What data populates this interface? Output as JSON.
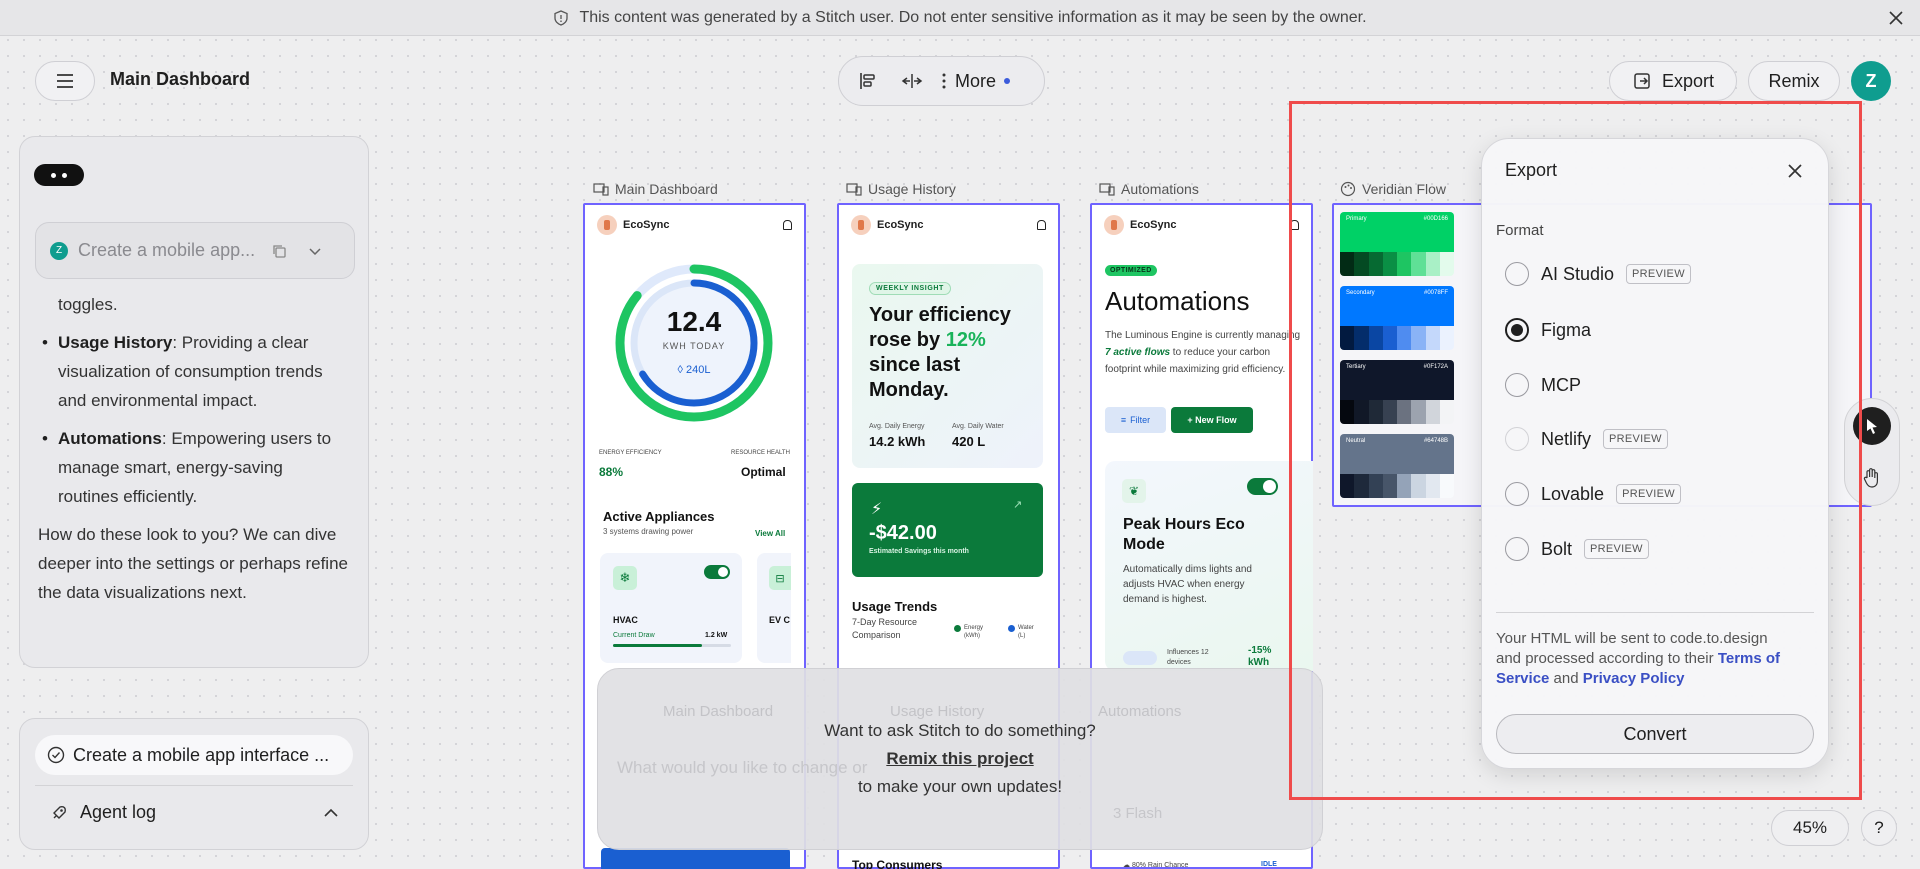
{
  "banner": {
    "text": "This content was generated by a Stitch user. Do not enter sensitive information as it may be seen by the owner."
  },
  "header": {
    "title": "Main Dashboard",
    "toolbar_more": "More",
    "export_label": "Export",
    "remix_label": "Remix",
    "avatar_initial": "Z"
  },
  "chat": {
    "prompt_placeholder": "Create a mobile app...",
    "fragment": "toggles.",
    "items": [
      {
        "title": "Usage History",
        "text": ": Providing a clear visualization of consumption trends and environmental impact."
      },
      {
        "title": "Automations",
        "text": ": Empowering users to manage smart, energy-saving routines efficiently."
      }
    ],
    "closing": "How do these look to you? We can dive deeper into the settings or perhaps refine the data visualizations next.",
    "task_label": "Create a mobile app interface ...",
    "agent_log_label": "Agent log"
  },
  "artboards": {
    "main": {
      "label": "Main Dashboard",
      "app_name": "EcoSync",
      "kwh_value": "12.4",
      "kwh_label": "KWH TODAY",
      "water_value": "240L",
      "efficiency_label": "ENERGY EFFICIENCY",
      "efficiency_value": "88%",
      "health_label": "RESOURCE HEALTH",
      "health_value": "Optimal",
      "appliances_title": "Active Appliances",
      "appliances_sub": "3 systems drawing power",
      "view_all": "View All",
      "hvac_label": "HVAC",
      "hvac_draw_label": "Current Draw",
      "hvac_draw_value": "1.2 kW",
      "ev_label": "EV C"
    },
    "usage": {
      "label": "Usage History",
      "app_name": "EcoSync",
      "weekly_tag": "WEEKLY INSIGHT",
      "headline_1": "Your efficiency rose by ",
      "headline_pct": "12%",
      "headline_2": " since last Monday.",
      "energy_label": "Avg. Daily Energy",
      "energy_value": "14.2 kWh",
      "water_label": "Avg. Daily Water",
      "water_value": "420 L",
      "savings_value": "-$42.00",
      "savings_label": "Estimated Savings this month",
      "trends_title": "Usage Trends",
      "trends_sub": "7-Day Resource Comparison",
      "legend_energy": "Energy (kWh)",
      "legend_water": "Water (L)",
      "bottom_title": "Top Consumers"
    },
    "automations": {
      "label": "Automations",
      "app_name": "EcoSync",
      "tag": "OPTIMIZED",
      "title": "Automations",
      "desc_1": "The Luminous Engine is currently managing ",
      "desc_em": "7 active flows",
      "desc_2": " to reduce your carbon footprint while maximizing grid efficiency.",
      "filter_label": "Filter",
      "new_flow_label": "+ New Flow",
      "card_title": "Peak Hours Eco Mode",
      "card_desc": "Automatically dims lights and adjusts HVAC when energy demand is highest.",
      "influences": "Influences 12 devices",
      "savings": "-15% kWh",
      "rain": "80% Rain Chance",
      "idle": "IDLE"
    },
    "palette": {
      "label": "Veridian Flow",
      "swatches": [
        {
          "name": "Primary",
          "hex": "#00D166"
        },
        {
          "name": "Secondary",
          "hex": "#0078FF"
        },
        {
          "name": "Tertiary",
          "hex": "#0F172A"
        },
        {
          "name": "Neutral",
          "hex": "#64748B"
        }
      ]
    }
  },
  "remix_overlay": {
    "line1": "Want to ask Stitch to do something?",
    "link": "Remix this project",
    "line3": "to make your own updates!",
    "bg_tab_1": "Main Dashboard",
    "bg_tab_2": "Usage History",
    "bg_tab_3": "Automations",
    "bg_input": "What would you like to change or",
    "bg_model": "3 Flash"
  },
  "export_dialog": {
    "title": "Export",
    "format_label": "Format",
    "options": [
      {
        "label": "AI Studio",
        "badge": "PREVIEW",
        "selected": false
      },
      {
        "label": "Figma",
        "badge": "",
        "selected": true
      },
      {
        "label": "MCP",
        "badge": "",
        "selected": false
      },
      {
        "label": "Netlify",
        "badge": "PREVIEW",
        "selected": false
      },
      {
        "label": "Lovable",
        "badge": "PREVIEW",
        "selected": false
      },
      {
        "label": "Bolt",
        "badge": "PREVIEW",
        "selected": false
      }
    ],
    "note_1": "Your HTML will be sent to code.to.design and processed according to their ",
    "terms": "Terms of Service",
    "note_and": " and ",
    "privacy": "Privacy Policy",
    "convert_label": "Convert"
  },
  "footer": {
    "zoom": "45%",
    "help": "?"
  },
  "colors": {
    "accent": "#6f63ff",
    "brand_green": "#0b7a3b",
    "ring_green": "#1ec562",
    "ring_blue": "#1a5fd1",
    "highlight": "#ef4b4b"
  }
}
